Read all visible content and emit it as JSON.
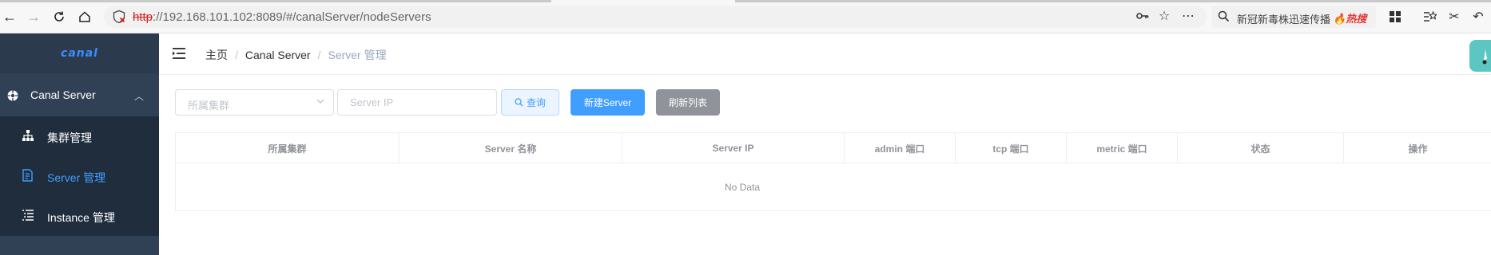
{
  "browser": {
    "url_scheme": "http",
    "url_host": "://192.168.101.102",
    "url_rest": ":8089/#/canalServer/nodeServers",
    "search_text": "新冠新毒株迅速传播",
    "search_hot": "热搜"
  },
  "sidebar": {
    "logo": "canal",
    "group_label": "Canal Server",
    "items": [
      {
        "label": "集群管理",
        "icon": "cluster-icon",
        "active": false
      },
      {
        "label": "Server 管理",
        "icon": "server-icon",
        "active": true
      },
      {
        "label": "Instance 管理",
        "icon": "list-icon",
        "active": false
      }
    ]
  },
  "header": {
    "breadcrumb": [
      "主页",
      "Canal Server",
      "Server 管理"
    ]
  },
  "filters": {
    "cluster_placeholder": "所属集群",
    "ip_placeholder": "Server IP",
    "query_label": "查询",
    "new_label": "新建Server",
    "refresh_label": "刷新列表"
  },
  "table": {
    "columns": [
      "所属集群",
      "Server 名称",
      "Server IP",
      "admin 端口",
      "tcp 端口",
      "metric 端口",
      "状态",
      "操作"
    ],
    "empty_text": "No Data"
  },
  "colors": {
    "sidebar_bg": "#304156",
    "submenu_bg": "#1f2d3d",
    "accent": "#409eff",
    "refresh_btn": "#909399"
  }
}
